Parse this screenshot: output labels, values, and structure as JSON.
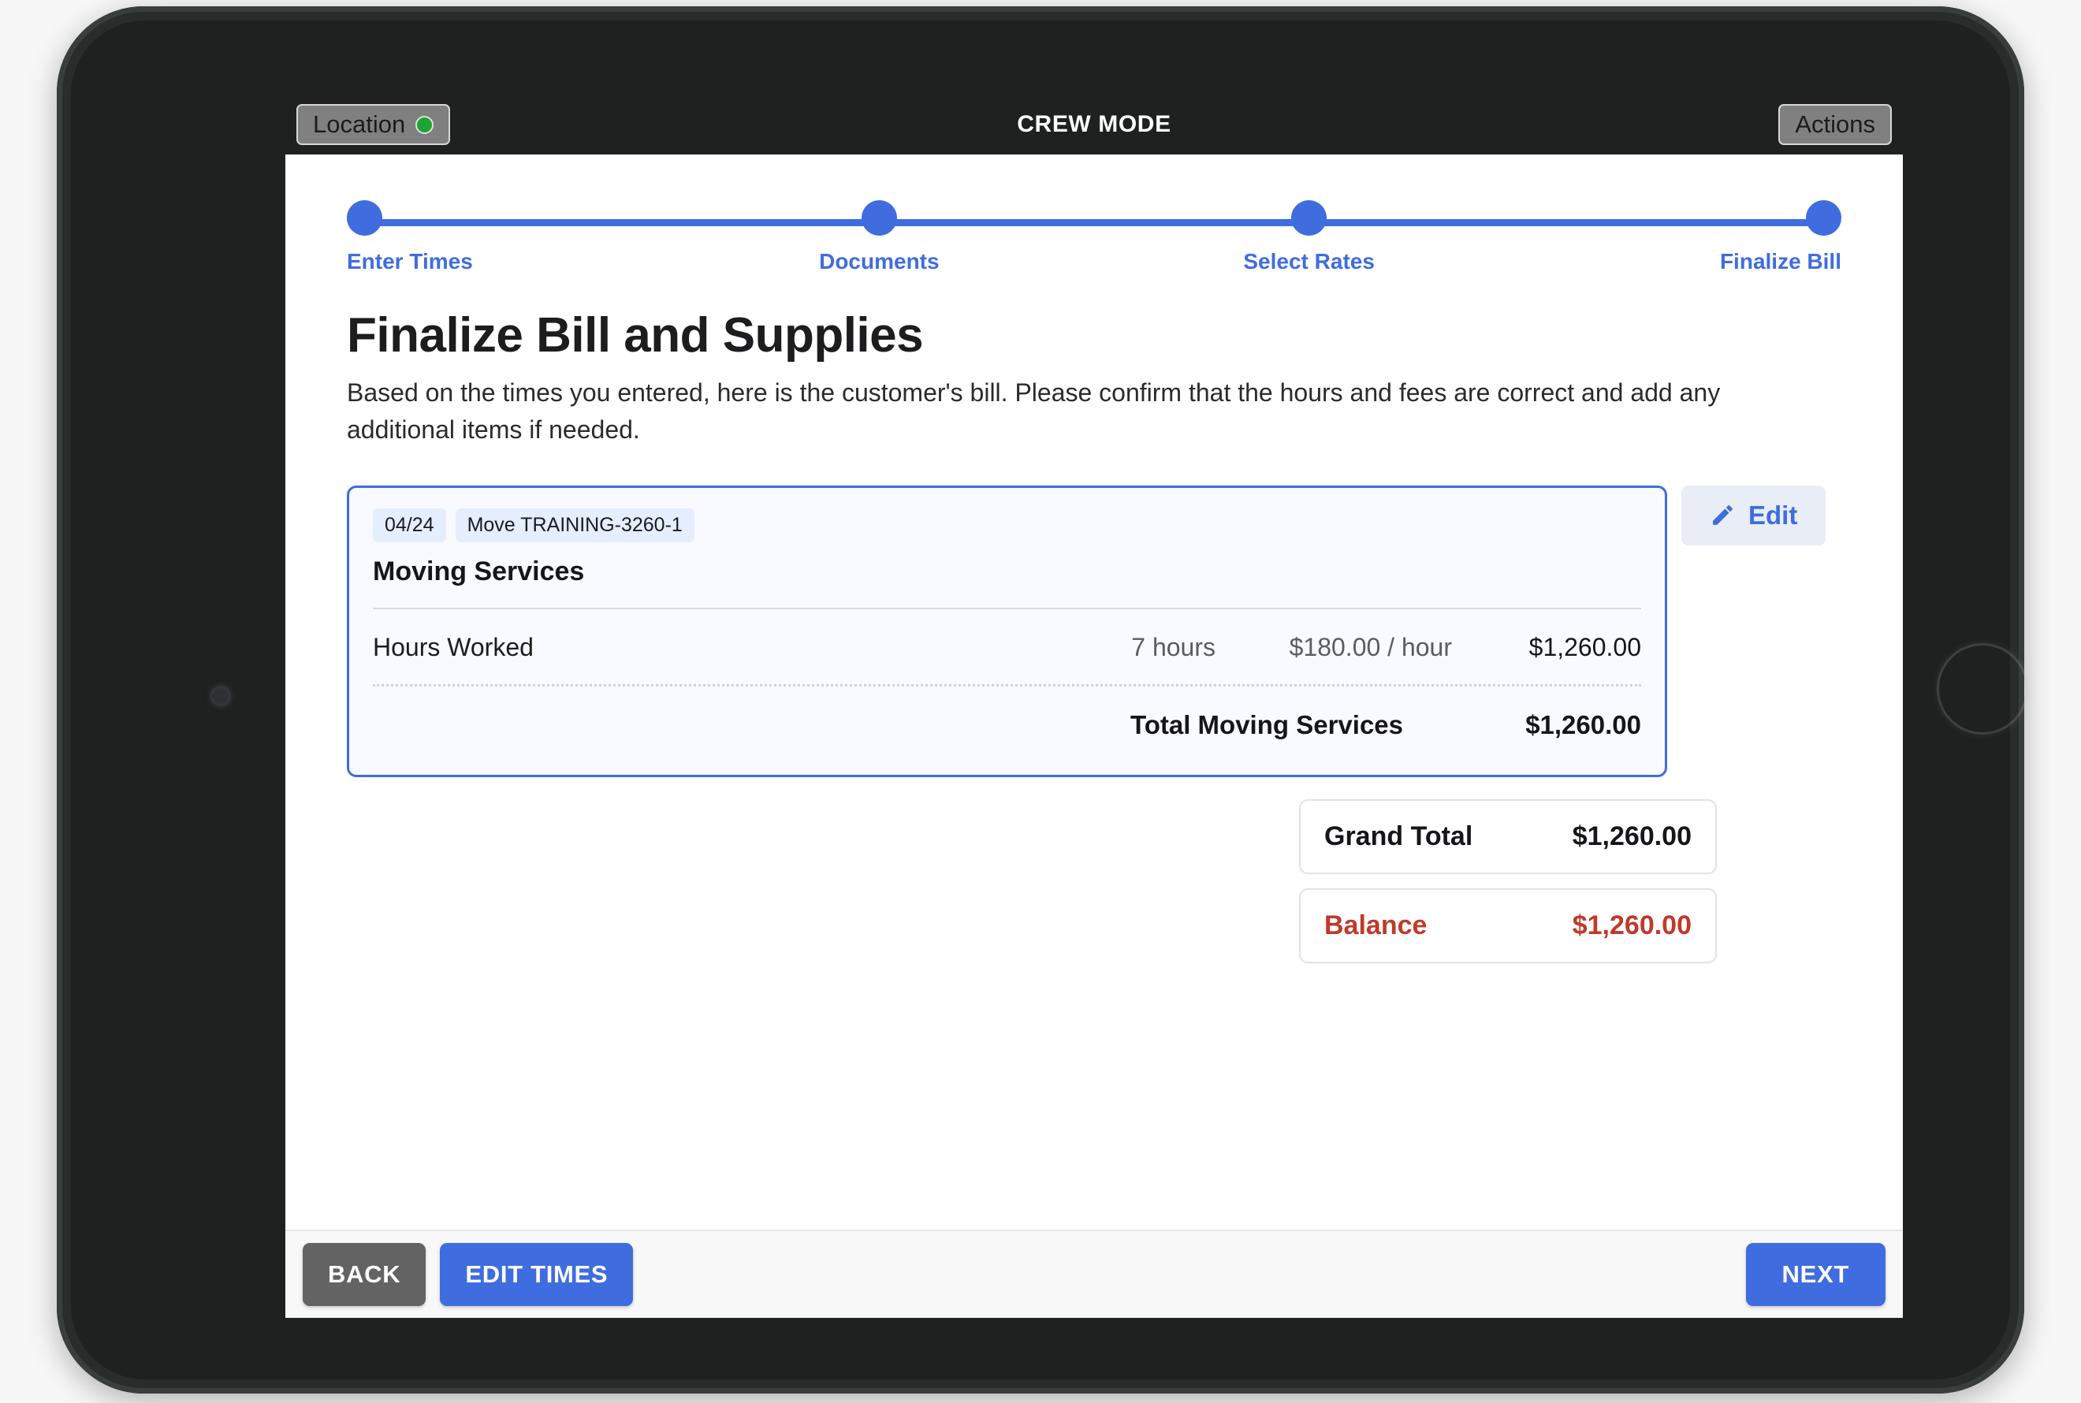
{
  "appbar": {
    "location_button": "Location",
    "title": "CREW MODE",
    "actions_button": "Actions"
  },
  "stepper": {
    "steps": [
      {
        "label": "Enter Times",
        "state": "complete"
      },
      {
        "label": "Documents",
        "state": "complete"
      },
      {
        "label": "Select Rates",
        "state": "complete"
      },
      {
        "label": "Finalize Bill",
        "state": "current"
      }
    ],
    "accent_color": "#3f6ddf"
  },
  "page": {
    "title": "Finalize Bill and Supplies",
    "description": "Based on the times you entered, here is the customer's bill. Please confirm that the hours and fees are correct and add any additional items if needed."
  },
  "bill_card": {
    "badges": [
      "04/24",
      "Move TRAINING-3260-1"
    ],
    "heading": "Moving Services",
    "line_items": [
      {
        "name": "Hours Worked",
        "quantity": "7 hours",
        "rate": "$180.00 / hour",
        "amount": "$1,260.00"
      }
    ],
    "section_total_label": "Total Moving Services",
    "section_total_amount": "$1,260.00",
    "border_color": "#3f6ddf"
  },
  "edit_button": {
    "label": "Edit",
    "icon": "pencil-icon",
    "color": "#3f6ddf"
  },
  "summary": {
    "grand_total": {
      "label": "Grand Total",
      "value": "$1,260.00"
    },
    "balance": {
      "label": "Balance",
      "value": "$1,260.00",
      "color": "#c0392b"
    }
  },
  "footer": {
    "back": "BACK",
    "edit_times": "EDIT TIMES",
    "next": "NEXT"
  }
}
